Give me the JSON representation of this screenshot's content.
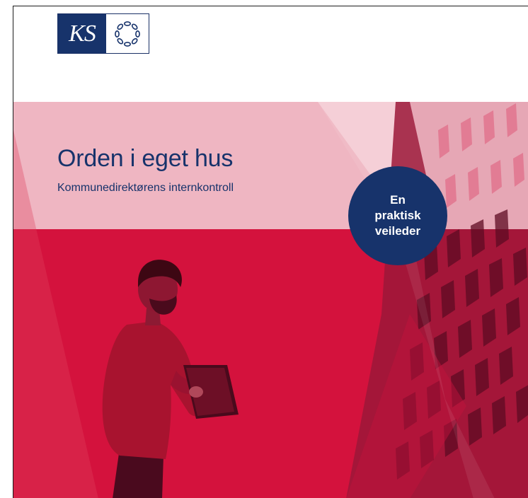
{
  "logo": {
    "wordmark": "KS",
    "seal_icon": "chain-seal-icon"
  },
  "cover": {
    "title": "Orden i eget hus",
    "subtitle": "Kommunedirektørens internkontroll",
    "badge": {
      "line1": "En",
      "line2": "praktisk",
      "line3": "veileder"
    }
  },
  "colors": {
    "navy": "#17336b",
    "pink_light": "#efb6c2",
    "pink_pale": "#f5cfd7",
    "red": "#d4123d",
    "red_dark": "#a30f33"
  }
}
